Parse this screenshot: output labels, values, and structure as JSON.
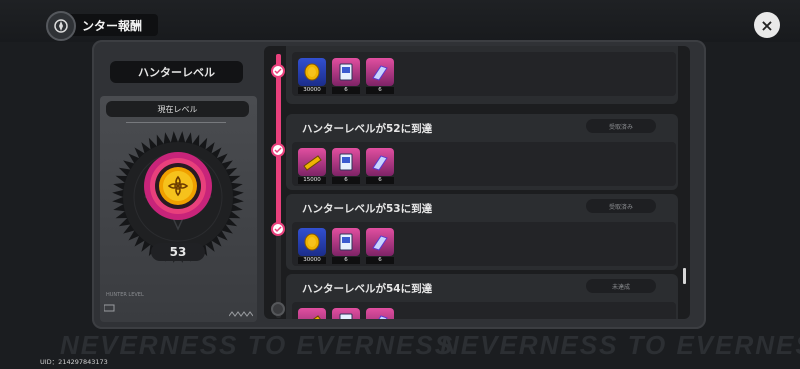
{
  "header": {
    "title": "ンター報酬",
    "close_icon": "×"
  },
  "background": {
    "slogan": "NEVERNESS TO EVERNESS"
  },
  "left_card": {
    "label": "ハンターレベル",
    "current_label": "現在レベル",
    "level": "53",
    "footer_text": "HUNTER LEVEL"
  },
  "milestones": [
    {
      "title": "",
      "status": "",
      "completed": true,
      "rewards": [
        {
          "icon": "gold-coin-icon",
          "qty": "30000"
        },
        {
          "icon": "card-icon",
          "qty": "6"
        },
        {
          "icon": "crystal-icon",
          "qty": "6"
        }
      ]
    },
    {
      "title": "ハンターレベルが52に到達",
      "status": "受取済み",
      "completed": true,
      "rewards": [
        {
          "icon": "ticket-icon",
          "qty": "15000"
        },
        {
          "icon": "card-icon",
          "qty": "6"
        },
        {
          "icon": "crystal-icon",
          "qty": "6"
        }
      ]
    },
    {
      "title": "ハンターレベルが53に到達",
      "status": "受取済み",
      "completed": true,
      "rewards": [
        {
          "icon": "gold-coin-icon",
          "qty": "30000"
        },
        {
          "icon": "card-icon",
          "qty": "6"
        },
        {
          "icon": "crystal-icon",
          "qty": "6"
        }
      ]
    },
    {
      "title": "ハンターレベルが54に到達",
      "status": "未達成",
      "completed": false,
      "rewards": [
        {
          "icon": "ticket-icon",
          "qty": ""
        },
        {
          "icon": "card-icon",
          "qty": ""
        },
        {
          "icon": "crystal-icon",
          "qty": ""
        }
      ]
    }
  ],
  "uid": "UID：214297843173",
  "colors": {
    "accent": "#e8407c",
    "gold": "#f0b400",
    "reward_blue": "#3250d0",
    "reward_pink": "#e14fa0"
  }
}
